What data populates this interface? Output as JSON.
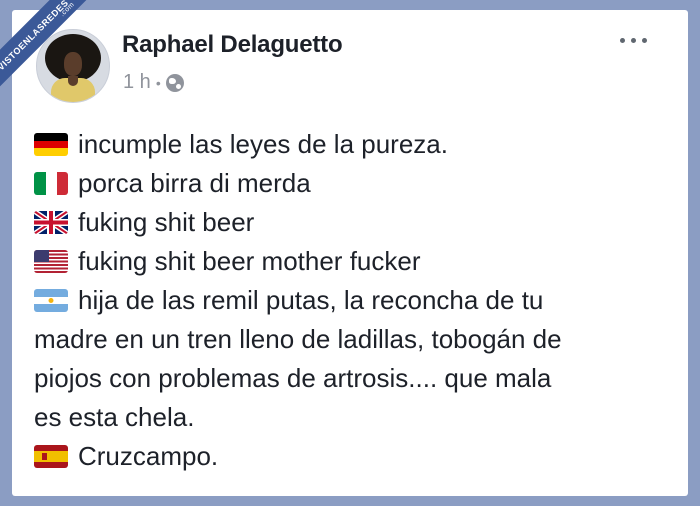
{
  "watermark": {
    "text": "VISTOENLASREDES",
    "suffix": ".com"
  },
  "post": {
    "author": "Raphael Delaguetto",
    "time": "1 h",
    "separator": "•",
    "privacy_icon": "globe-icon",
    "menu_icon": "more-options-icon",
    "lines": [
      {
        "flag": "germany-flag-icon",
        "text": "incumple las leyes de la pureza."
      },
      {
        "flag": "italy-flag-icon",
        "text": "porca birra di merda"
      },
      {
        "flag": "uk-flag-icon",
        "text": "fuking shit beer"
      },
      {
        "flag": "usa-flag-icon",
        "text": "fuking shit beer mother fucker"
      },
      {
        "flag": "argentina-flag-icon",
        "text": "hija de las remil putas, la reconcha de tu",
        "continuation": [
          "madre en un tren lleno de ladillas, tobogán de",
          "piojos con problemas de artrosis.... que mala",
          "es esta chela."
        ]
      },
      {
        "flag": "spain-flag-icon",
        "text": "Cruzcampo."
      }
    ]
  },
  "colors": {
    "background": "#8b9dc3",
    "card": "#ffffff",
    "author_text": "#1d2129",
    "meta_text": "#90949c",
    "watermark": "#3b5998"
  }
}
